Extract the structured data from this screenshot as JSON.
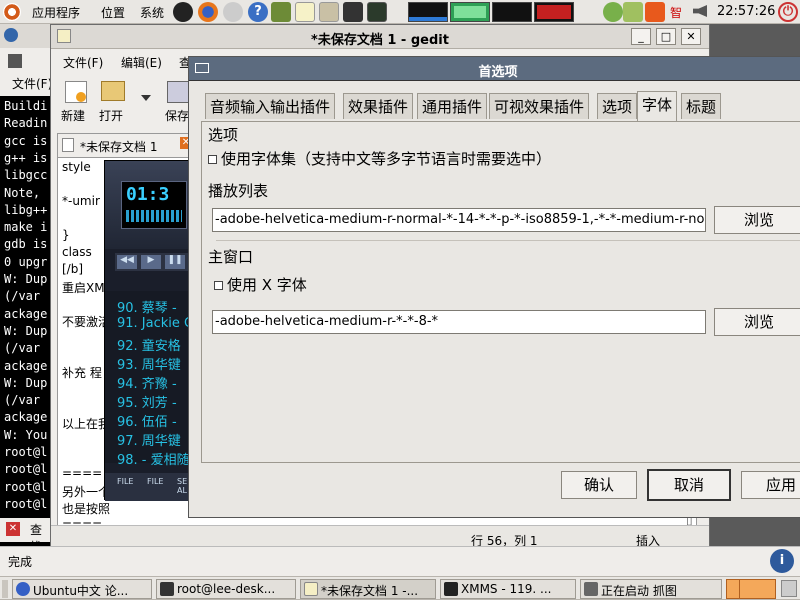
{
  "top_panel": {
    "menus": [
      "应用程序",
      "位置",
      "系统"
    ],
    "clock": "22:57:26",
    "tray_text": "智"
  },
  "terminal": {
    "lines": [
      "Buildi",
      "Readin",
      "gcc is",
      "g++ is",
      "libgcc",
      "Note, ",
      "libg++",
      "make i",
      "gdb is",
      "0 upgr",
      "W: Dup",
      " (/var",
      "ackage",
      "W: Dup",
      " (/var",
      "ackage",
      "W: Dup",
      " (/var",
      "ackage",
      "W: You",
      "root@l",
      "root@l",
      "root@l",
      "root@l"
    ]
  },
  "gedit": {
    "title": "*未保存文档 1 - gedit",
    "menus": [
      "文件(F)",
      "编辑(E)",
      "查"
    ],
    "toolbar": {
      "new": "新建",
      "open": "打开",
      "save": "保存"
    },
    "doc_tab": "*未保存文档 1",
    "editor_lines": [
      " style",
      " ",
      "*-umir",
      " ",
      " }",
      " class",
      "[/b]",
      "重启XMM",
      "",
      "不要激活",
      "",
      "",
      "补充 程",
      "",
      "",
      "以上在我",
      "",
      "",
      "====",
      "另外一个",
      "也是按照",
      "===="
    ],
    "status": {
      "position": "行 56，列 1",
      "mode": "插入"
    },
    "bottom_label": "查找"
  },
  "xmms": {
    "time": "01:3",
    "playlist": [
      "90. 蔡琴 - ",
      "91. Jackie C",
      "92. 童安格",
      "93. 周华键",
      "94. 齐豫 - ",
      "95. 刘芳 - ",
      "96. 伍佰 - ",
      "97. 周华键",
      "98. - 爱相随"
    ],
    "bottom_buttons": [
      "FILE",
      "FILE",
      "SE AL"
    ]
  },
  "terminal_side": {
    "label": "文件(F)"
  },
  "dialog": {
    "title": "首选项",
    "tabs": [
      "音频输入输出插件",
      "效果插件",
      "通用插件",
      "可视效果插件",
      "选项",
      "字体",
      "标题"
    ],
    "active_tab": "字体",
    "options_group": "选项",
    "use_fontset": "使用字体集（支持中文等多字节语言时需要选中）",
    "playlist_group": "播放列表",
    "playlist_font": "-adobe-helvetica-medium-r-normal-*-14-*-*-p-*-iso8859-1,-*-*-medium-r-norma",
    "browse": "浏览",
    "main_group": "主窗口",
    "use_x_font": "使用 X 字体",
    "main_font": "-adobe-helvetica-medium-r-*-*-8-*",
    "ok": "确认",
    "cancel": "取消",
    "apply": "应用"
  },
  "status_bar": {
    "text": "完成"
  },
  "taskbar": [
    "Ubuntu中文 论...",
    "root@lee-desk...",
    "*未保存文档 1 -...",
    "XMMS - 119. ...",
    "正在启动 抓图"
  ]
}
